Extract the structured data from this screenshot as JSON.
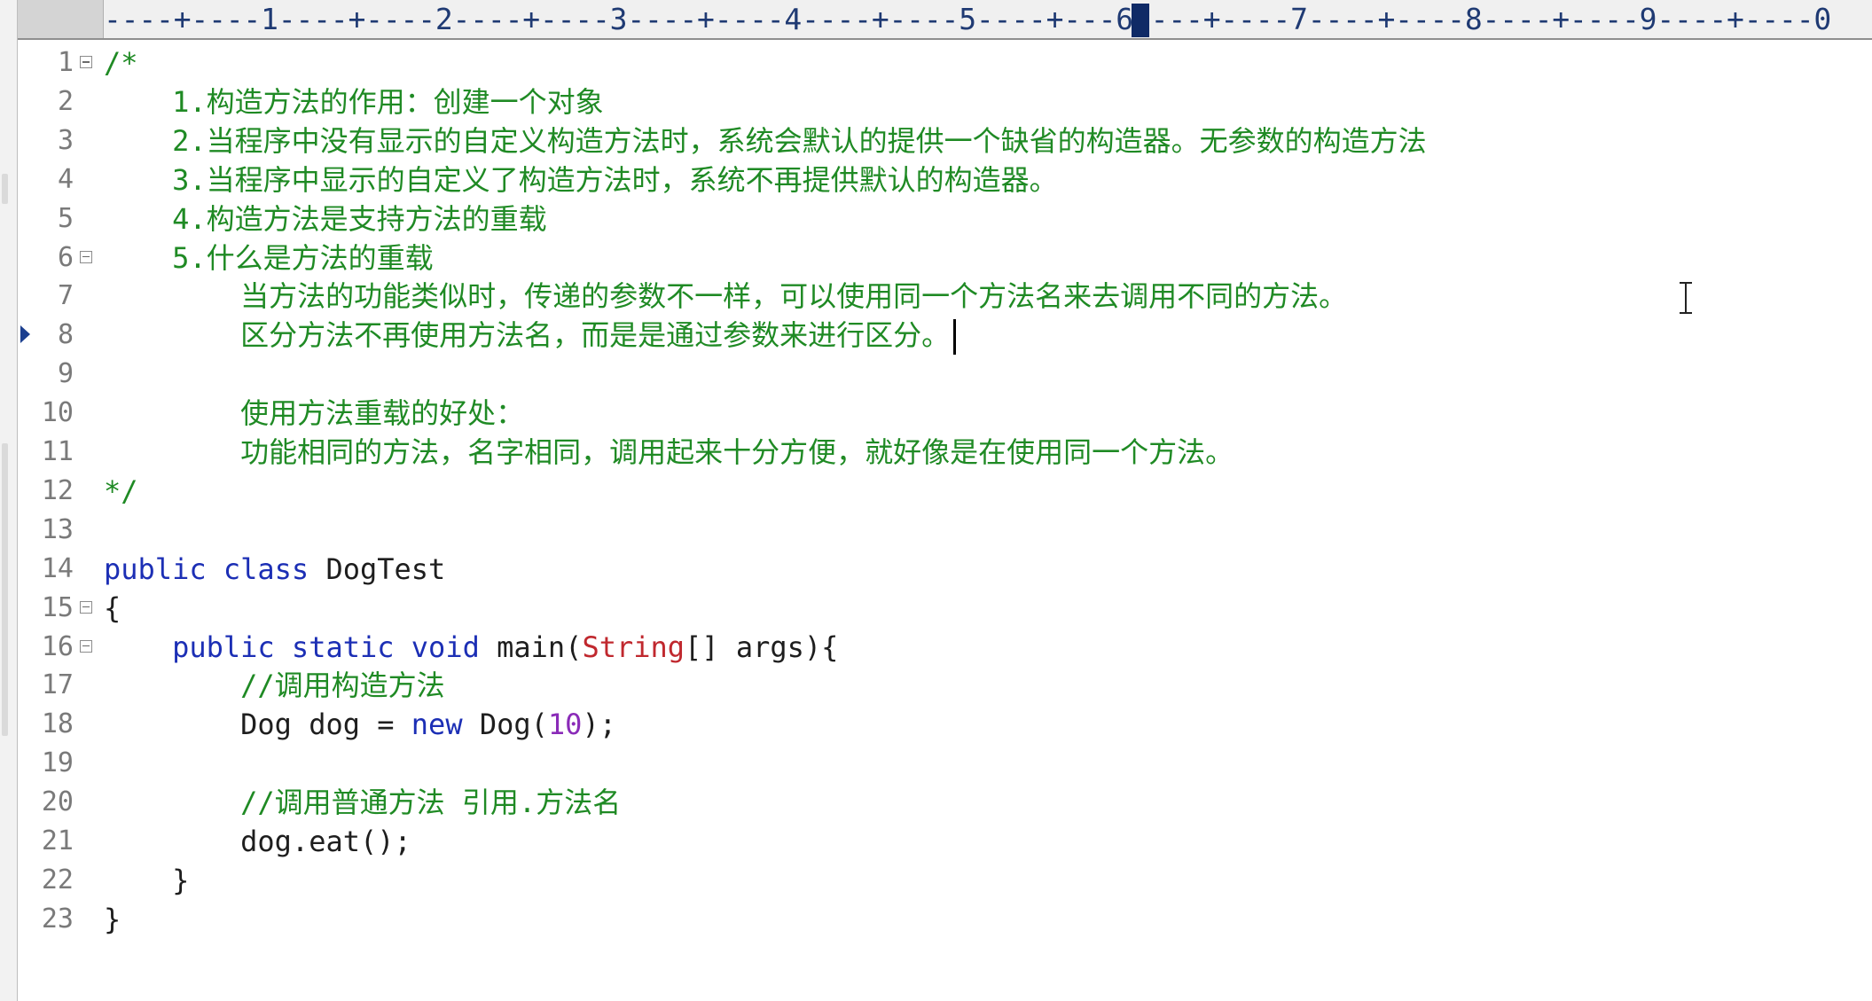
{
  "ruler": {
    "text": "----+----1----+----2----+----3----+----4----+----5----+---6----+----7----+----8----+----9----+----0"
  },
  "editor": {
    "lines": [
      {
        "num": "1",
        "fold": true,
        "mark": false,
        "segments": [
          {
            "cls": "cmt",
            "text": "/*"
          }
        ]
      },
      {
        "num": "2",
        "fold": false,
        "mark": false,
        "segments": [
          {
            "cls": "cmt",
            "text": "    1.构造方法的作用：创建一个对象"
          }
        ]
      },
      {
        "num": "3",
        "fold": false,
        "mark": false,
        "segments": [
          {
            "cls": "cmt",
            "text": "    2.当程序中没有显示的自定义构造方法时，系统会默认的提供一个缺省的构造器。无参数的构造方法"
          }
        ]
      },
      {
        "num": "4",
        "fold": false,
        "mark": false,
        "segments": [
          {
            "cls": "cmt",
            "text": "    3.当程序中显示的自定义了构造方法时，系统不再提供默认的构造器。"
          }
        ]
      },
      {
        "num": "5",
        "fold": false,
        "mark": false,
        "segments": [
          {
            "cls": "cmt",
            "text": "    4.构造方法是支持方法的重载"
          }
        ]
      },
      {
        "num": "6",
        "fold": true,
        "mark": false,
        "segments": [
          {
            "cls": "cmt",
            "text": "    5.什么是方法的重载"
          }
        ]
      },
      {
        "num": "7",
        "fold": false,
        "mark": false,
        "segments": [
          {
            "cls": "cmt",
            "text": "        当方法的功能类似时，传递的参数不一样，可以使用同一个方法名来去调用不同的方法。"
          }
        ]
      },
      {
        "num": "8",
        "fold": false,
        "mark": true,
        "caret": true,
        "segments": [
          {
            "cls": "cmt",
            "text": "        区分方法不再使用方法名，而是是通过参数来进行区分。"
          }
        ]
      },
      {
        "num": "9",
        "fold": false,
        "mark": false,
        "segments": []
      },
      {
        "num": "10",
        "fold": false,
        "mark": false,
        "segments": [
          {
            "cls": "cmt",
            "text": "        使用方法重载的好处："
          }
        ]
      },
      {
        "num": "11",
        "fold": false,
        "mark": false,
        "segments": [
          {
            "cls": "cmt",
            "text": "        功能相同的方法，名字相同，调用起来十分方便，就好像是在使用同一个方法。"
          }
        ]
      },
      {
        "num": "12",
        "fold": false,
        "mark": false,
        "segments": [
          {
            "cls": "cmt",
            "text": "*/"
          }
        ]
      },
      {
        "num": "13",
        "fold": false,
        "mark": false,
        "segments": []
      },
      {
        "num": "14",
        "fold": false,
        "mark": false,
        "segments": [
          {
            "cls": "kw",
            "text": "public"
          },
          {
            "cls": "plain",
            "text": " "
          },
          {
            "cls": "kw",
            "text": "class"
          },
          {
            "cls": "plain",
            "text": " DogTest"
          }
        ]
      },
      {
        "num": "15",
        "fold": true,
        "mark": false,
        "segments": [
          {
            "cls": "plain",
            "text": "{"
          }
        ]
      },
      {
        "num": "16",
        "fold": true,
        "mark": false,
        "segments": [
          {
            "cls": "plain",
            "text": "    "
          },
          {
            "cls": "kw",
            "text": "public"
          },
          {
            "cls": "plain",
            "text": " "
          },
          {
            "cls": "kw",
            "text": "static"
          },
          {
            "cls": "plain",
            "text": " "
          },
          {
            "cls": "kw",
            "text": "void"
          },
          {
            "cls": "plain",
            "text": " main("
          },
          {
            "cls": "typ",
            "text": "String"
          },
          {
            "cls": "plain",
            "text": "[] args){"
          }
        ]
      },
      {
        "num": "17",
        "fold": false,
        "mark": false,
        "segments": [
          {
            "cls": "plain",
            "text": "        "
          },
          {
            "cls": "cmt",
            "text": "//调用构造方法"
          }
        ]
      },
      {
        "num": "18",
        "fold": false,
        "mark": false,
        "segments": [
          {
            "cls": "plain",
            "text": "        Dog dog = "
          },
          {
            "cls": "kw",
            "text": "new"
          },
          {
            "cls": "plain",
            "text": " Dog("
          },
          {
            "cls": "num",
            "text": "10"
          },
          {
            "cls": "plain",
            "text": ");"
          }
        ]
      },
      {
        "num": "19",
        "fold": false,
        "mark": false,
        "segments": []
      },
      {
        "num": "20",
        "fold": false,
        "mark": false,
        "segments": [
          {
            "cls": "plain",
            "text": "        "
          },
          {
            "cls": "cmt",
            "text": "//调用普通方法 引用.方法名"
          }
        ]
      },
      {
        "num": "21",
        "fold": false,
        "mark": false,
        "segments": [
          {
            "cls": "plain",
            "text": "        dog.eat();"
          }
        ]
      },
      {
        "num": "22",
        "fold": false,
        "mark": false,
        "segments": [
          {
            "cls": "plain",
            "text": "    }"
          }
        ]
      },
      {
        "num": "23",
        "fold": false,
        "mark": false,
        "segments": [
          {
            "cls": "plain",
            "text": "}"
          }
        ]
      }
    ]
  }
}
